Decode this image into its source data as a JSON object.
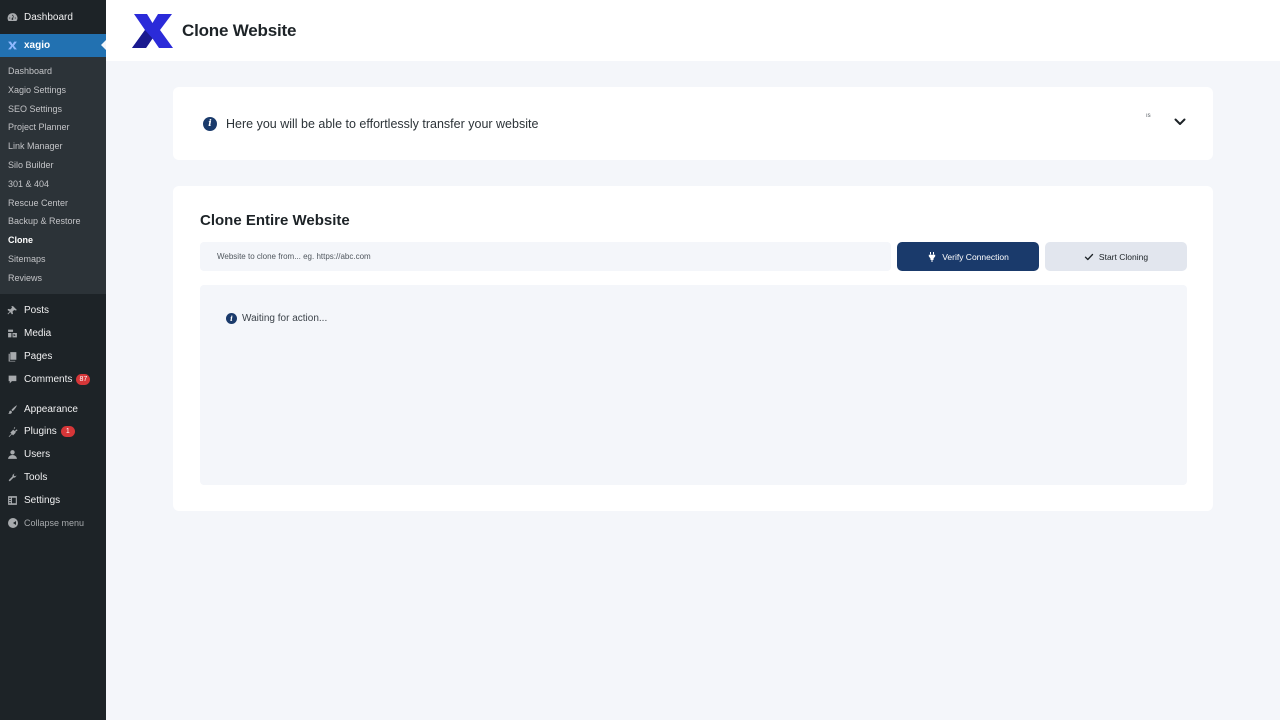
{
  "sidebar": {
    "dashboard": {
      "label": "Dashboard",
      "icon": "dashboard-icon"
    },
    "active_plugin": {
      "label": "xagio",
      "icon": "xagio-icon"
    },
    "submenu": [
      {
        "label": "Dashboard"
      },
      {
        "label": "Xagio Settings"
      },
      {
        "label": "SEO Settings"
      },
      {
        "label": "Project Planner"
      },
      {
        "label": "Link Manager"
      },
      {
        "label": "Silo Builder"
      },
      {
        "label": "301 & 404"
      },
      {
        "label": "Rescue Center"
      },
      {
        "label": "Backup & Restore"
      },
      {
        "label": "Clone"
      },
      {
        "label": "Sitemaps"
      },
      {
        "label": "Reviews"
      }
    ],
    "current_submenu": "Clone",
    "menu": [
      {
        "label": "Posts",
        "icon": "pushpin-icon"
      },
      {
        "label": "Media",
        "icon": "media-icon"
      },
      {
        "label": "Pages",
        "icon": "pages-icon"
      },
      {
        "label": "Comments",
        "icon": "comment-icon",
        "badge": "87"
      },
      {
        "label": "Appearance",
        "icon": "paintbrush-icon"
      },
      {
        "label": "Plugins",
        "icon": "plugin-icon",
        "badge": "1"
      },
      {
        "label": "Users",
        "icon": "user-icon"
      },
      {
        "label": "Tools",
        "icon": "wrench-icon"
      },
      {
        "label": "Settings",
        "icon": "settings-icon"
      }
    ],
    "collapse_label": "Collapse menu"
  },
  "header": {
    "title": "Clone Website",
    "logo": "xagio-logo"
  },
  "info": {
    "text": "Here you will be able to effortlessly transfer your website",
    "tiny_mark": "ıs",
    "toggle_icon": "chevron-down-icon"
  },
  "clone": {
    "title": "Clone Entire Website",
    "url_value": "",
    "url_placeholder": "Website to clone from... eg. https://abc.com",
    "verify_label": "Verify Connection",
    "start_label": "Start Cloning",
    "status": "Waiting for action..."
  },
  "colors": {
    "sidebar_bg": "#1d2327",
    "active_menu": "#2271b1",
    "primary_button": "#1a3a6b",
    "badge": "#d63638",
    "page_bg": "#f4f6fa"
  }
}
